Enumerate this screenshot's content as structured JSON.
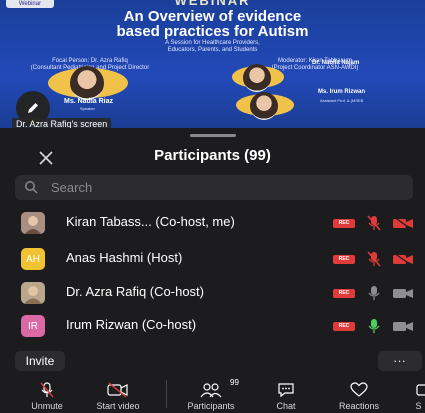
{
  "shared_screen": {
    "webinar_word": "WEBINAR",
    "webinar_tag": "Webinar",
    "title_line1": "An Overview of evidence",
    "title_line2": "based practices for Autism",
    "subtitle_line1": "A Session for Healthcare Providers,",
    "subtitle_line2": "Educators, Parents, and Students",
    "focal_label": "Focal Person: Dr. Azra Rafiq",
    "focal_detail": "(Consultant Pediatrician and Project Director ASN-AWDI)",
    "moderator_label": "Moderator: Kiran Tabbasum",
    "moderator_detail": "(Project Coordinator ASN-AWDI)",
    "speaker1_name": "Ms. Nadia Riaz",
    "speaker1_role": "Speaker",
    "speaker2_name": "Dr. Nabila Najam",
    "speaker3_name": "Ms. Irum Rizwan",
    "speaker3_role": "Assistant Prof. & (MSEB",
    "share_label": "Dr. Azra Rafiq's screen"
  },
  "panel": {
    "title": "Participants (99)",
    "search_placeholder": "Search",
    "participants": [
      {
        "name": "Kiran Tabass...  (Co-host, me)",
        "initials": "",
        "rec": "REC",
        "mic": "muted",
        "video": "off"
      },
      {
        "name": "Anas Hashmi (Host)",
        "initials": "AH",
        "rec": "REC",
        "mic": "muted",
        "video": "off"
      },
      {
        "name": "Dr. Azra Rafiq (Co-host)",
        "initials": "",
        "rec": "REC",
        "mic": "idle",
        "video": "off-grey"
      },
      {
        "name": "Irum Rizwan (Co-host)",
        "initials": "IR",
        "rec": "REC",
        "mic": "active",
        "video": "off-grey"
      }
    ],
    "invite_label": "Invite",
    "more_label": "..."
  },
  "toolbar": {
    "unmute": "Unmute",
    "start_video": "Start video",
    "participants": "Participants",
    "participants_count": "99",
    "chat": "Chat",
    "reactions": "Reactions",
    "share": "S"
  },
  "colors": {
    "rec": "#e03a3a",
    "muted": "#e03a3a",
    "active_mic": "#4cd05c",
    "background": "#1c1c1e",
    "avatar_yellow": "#f1c232",
    "avatar_pink": "#d96aa5"
  }
}
